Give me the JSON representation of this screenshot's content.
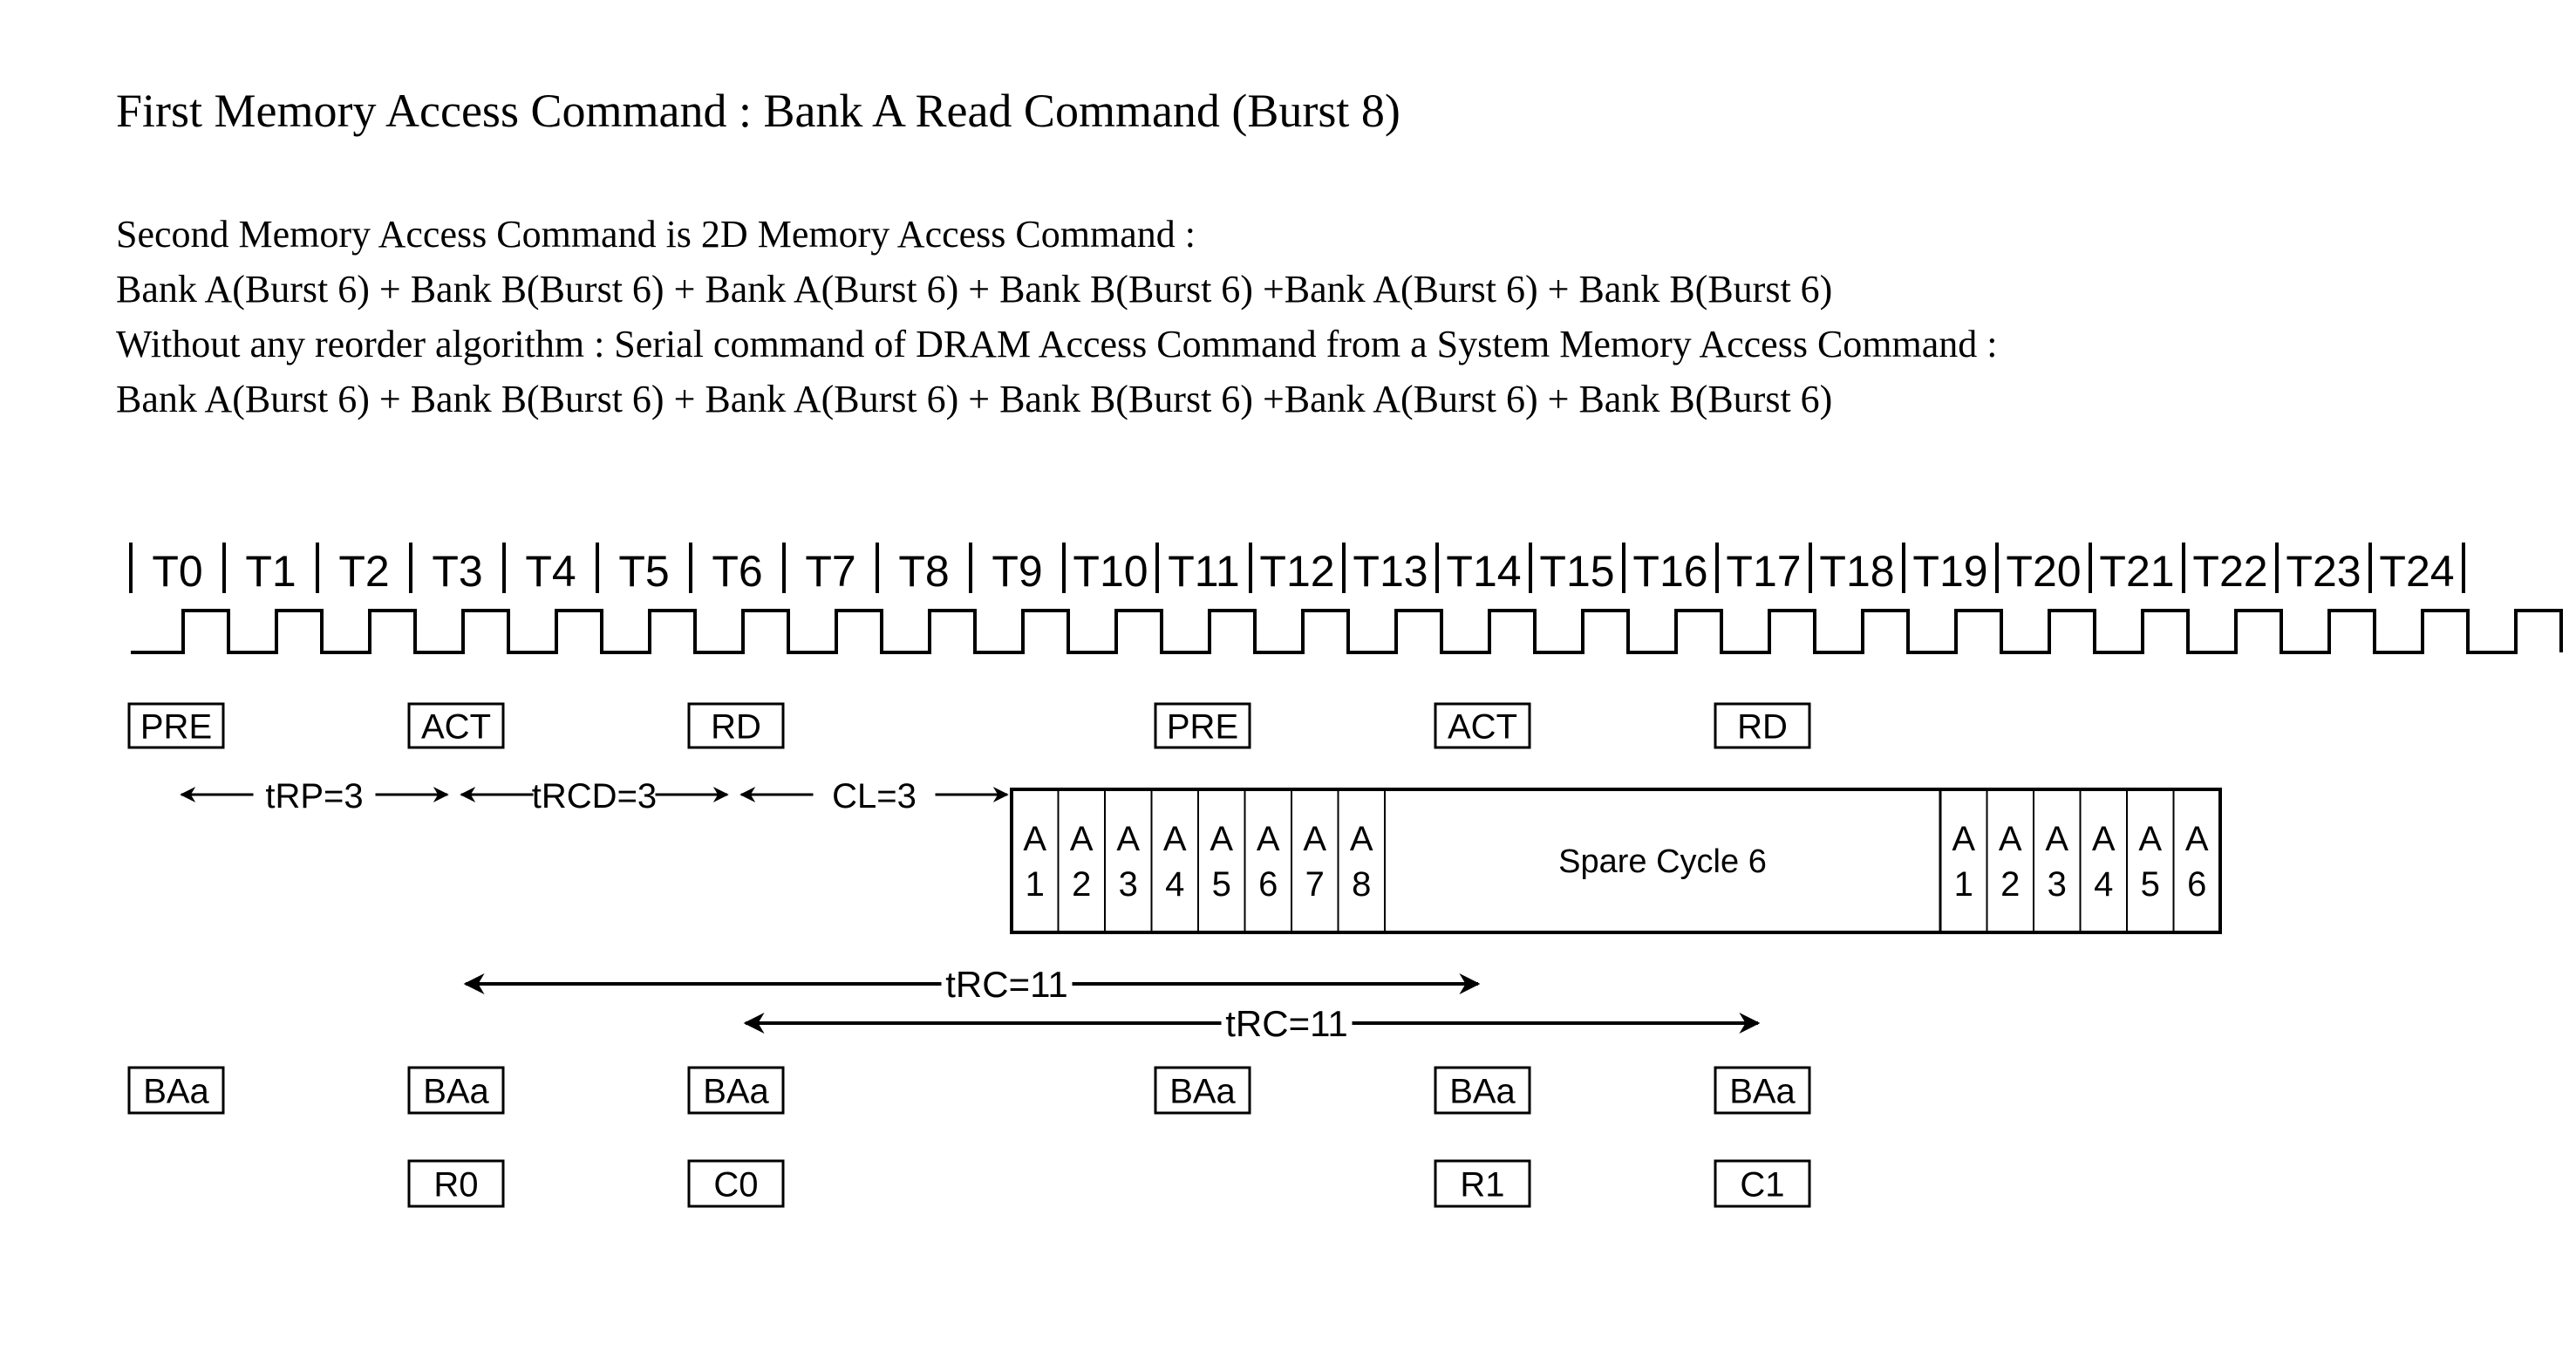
{
  "header": {
    "first_command": "First Memory Access Command : Bank A Read Command (Burst 8)",
    "second_command_intro": "Second  Memory Access Command is 2D Memory Access Command :",
    "second_command_sequence": "Bank A(Burst 6) + Bank B(Burst 6) + Bank A(Burst 6) + Bank B(Burst 6) +Bank A(Burst 6) + Bank B(Burst 6)",
    "without_reorder": "Without any reorder algorithm : Serial command of DRAM Access Command from a System Memory Access Command :",
    "serial_sequence": "Bank A(Burst 6) + Bank B(Burst 6) + Bank A(Burst 6) + Bank B(Burst 6) +Bank A(Burst 6) + Bank B(Burst 6)"
  },
  "timeline": {
    "ticks": [
      "T0",
      "T1",
      "T2",
      "T3",
      "T4",
      "T5",
      "T6",
      "T7",
      "T8",
      "T9",
      "T10",
      "T11",
      "T12",
      "T13",
      "T14",
      "T15",
      "T16",
      "T17",
      "T18",
      "T19",
      "T20",
      "T21",
      "T22",
      "T23",
      "T24"
    ],
    "clock_cycles": 26
  },
  "commands": [
    {
      "label": "PRE",
      "cycle": 0
    },
    {
      "label": "ACT",
      "cycle": 3
    },
    {
      "label": "RD",
      "cycle": 6
    },
    {
      "label": "PRE",
      "cycle": 11
    },
    {
      "label": "ACT",
      "cycle": 14
    },
    {
      "label": "RD",
      "cycle": 17
    }
  ],
  "timing_params": [
    {
      "label": "tRP=3",
      "from_cycle": 0,
      "to_cycle": 3
    },
    {
      "label": "tRCD=3",
      "from_cycle": 3,
      "to_cycle": 6
    },
    {
      "label": "CL=3",
      "from_cycle": 6,
      "to_cycle": 9
    }
  ],
  "data_bus": {
    "first_burst": [
      {
        "bank": "A",
        "index": "1"
      },
      {
        "bank": "A",
        "index": "2"
      },
      {
        "bank": "A",
        "index": "3"
      },
      {
        "bank": "A",
        "index": "4"
      },
      {
        "bank": "A",
        "index": "5"
      },
      {
        "bank": "A",
        "index": "6"
      },
      {
        "bank": "A",
        "index": "7"
      },
      {
        "bank": "A",
        "index": "8"
      }
    ],
    "spare_label": "Spare Cycle 6",
    "second_burst": [
      {
        "bank": "A",
        "index": "1"
      },
      {
        "bank": "A",
        "index": "2"
      },
      {
        "bank": "A",
        "index": "3"
      },
      {
        "bank": "A",
        "index": "4"
      },
      {
        "bank": "A",
        "index": "5"
      },
      {
        "bank": "A",
        "index": "6"
      }
    ]
  },
  "trc_arrows": [
    {
      "label": "tRC=11",
      "from_cycle": 3,
      "to_cycle": 14
    },
    {
      "label": "tRC=11",
      "from_cycle": 6,
      "to_cycle": 17
    }
  ],
  "bank_row": [
    {
      "label": "BAa",
      "cycle": 0
    },
    {
      "label": "BAa",
      "cycle": 3
    },
    {
      "label": "BAa",
      "cycle": 6
    },
    {
      "label": "BAa",
      "cycle": 11
    },
    {
      "label": "BAa",
      "cycle": 14
    },
    {
      "label": "BAa",
      "cycle": 17
    }
  ],
  "address_row": [
    {
      "label": "R0",
      "cycle": 3
    },
    {
      "label": "C0",
      "cycle": 6
    },
    {
      "label": "R1",
      "cycle": 14
    },
    {
      "label": "C1",
      "cycle": 17
    }
  ]
}
